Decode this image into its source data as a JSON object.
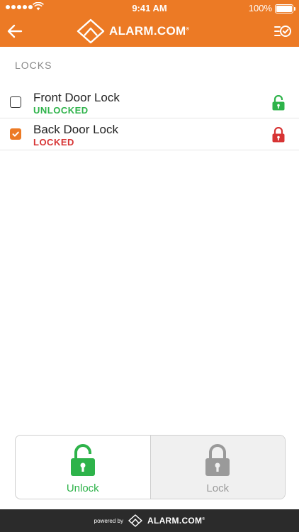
{
  "status_bar": {
    "time": "9:41 AM",
    "battery": "100%"
  },
  "header": {
    "brand": "ALARM.COM",
    "brand_mark": "®"
  },
  "section": {
    "title": "LOCKS"
  },
  "locks": [
    {
      "name": "Front Door Lock",
      "state": "UNLOCKED",
      "selected": false
    },
    {
      "name": "Back Door Lock",
      "state": "LOCKED",
      "selected": true
    }
  ],
  "actions": {
    "unlock_label": "Unlock",
    "lock_label": "Lock"
  },
  "footer": {
    "powered_by": "powered by",
    "brand": "ALARM.COM",
    "brand_mark": "®"
  },
  "colors": {
    "accent": "#ec7a25",
    "unlocked": "#2eb34a",
    "locked": "#d73434",
    "footer": "#2b2b2b"
  },
  "icons": [
    "back-arrow-icon",
    "alarm-logo-icon",
    "task-list-icon",
    "checkbox-icon",
    "unlocked-padlock-icon",
    "locked-padlock-icon"
  ]
}
